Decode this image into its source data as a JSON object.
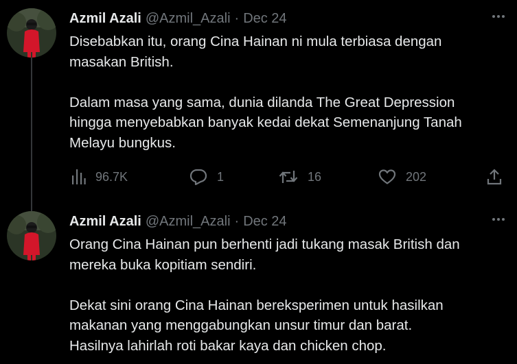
{
  "tweets": [
    {
      "name": "Azmil Azali",
      "handle": "@Azmil_Azali",
      "separator": "·",
      "date": "Dec 24",
      "lines": [
        "Disebabkan itu, orang Cina Hainan ni mula terbiasa dengan",
        "masakan British.",
        "",
        "Dalam masa yang sama, dunia dilanda The Great Depression",
        "hingga menyebabkan banyak kedai dekat Semenanjung Tanah",
        "Melayu bungkus."
      ],
      "views": "96.7K",
      "replies": "1",
      "retweets": "16",
      "likes": "202"
    },
    {
      "name": "Azmil Azali",
      "handle": "@Azmil_Azali",
      "separator": "·",
      "date": "Dec 24",
      "lines": [
        "Orang Cina Hainan pun berhenti jadi tukang masak British dan",
        "mereka buka kopitiam sendiri.",
        "",
        "Dekat sini orang Cina Hainan bereksperimen untuk hasilkan",
        "makanan yang menggabungkan unsur timur dan barat.",
        "Hasilnya lahirlah roti bakar kaya dan chicken chop."
      ]
    }
  ],
  "icons": {
    "views": "bar-chart-icon",
    "reply": "speech-bubble-icon",
    "retweet": "retweet-arrows-icon",
    "like": "heart-icon",
    "share": "share-upload-icon",
    "more": "more-dots-icon"
  },
  "colors": {
    "background": "#000000",
    "text": "#e7e9ea",
    "muted": "#71767b",
    "thread_line": "#333639"
  }
}
